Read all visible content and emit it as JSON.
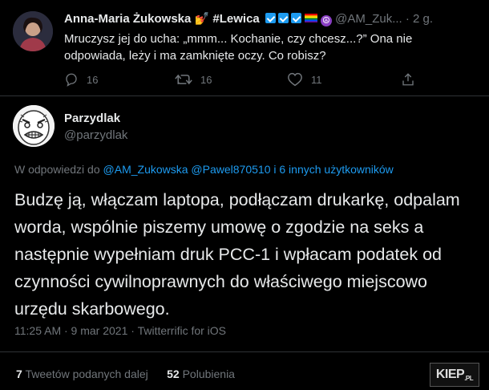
{
  "top_tweet": {
    "author_name": "Anna-Maria Żukowska",
    "emoji_hand": "💅",
    "hashtag": "#Lewica",
    "handle": "@AM_Zuk...",
    "time": "· 2 g.",
    "text": "Mruczysz jej do ucha: „mmm... Kochanie, czy chcesz...?” Ona nie odpowiada, leży i ma zamknięte oczy. Co robisz?",
    "reply_count": "16",
    "retweet_count": "16",
    "like_count": "11"
  },
  "main_tweet": {
    "author_name": "Parzydlak",
    "handle": "@parzydlak",
    "reply_prefix": "W odpowiedzi do",
    "reply_mentions": "@AM_Zukowska @Pawel870510",
    "reply_others": "i 6 innych użytkowników",
    "text": "Budzę ją, włączam laptopa, podłączam drukarkę, odpalam worda, wspólnie piszemy umowę o zgodzie na seks a następnie wypełniam druk PCC-1 i wpłacam podatek od czynności cywilnoprawnych do właściwego miejscowo urzędu skarbowego.",
    "meta": "11:25 AM · 9 mar 2021 · Twitterrific for iOS",
    "retweets_value": "7",
    "retweets_label": "Tweetów podanych dalej",
    "likes_value": "52",
    "likes_label": "Polubienia"
  },
  "watermark": {
    "text": "KIEP",
    "suffix": ".PL"
  },
  "icons": [
    "reply-icon",
    "retweet-icon",
    "like-icon",
    "share-icon",
    "verified-badge-icon",
    "rainbow-flag-icon",
    "peace-icon"
  ]
}
